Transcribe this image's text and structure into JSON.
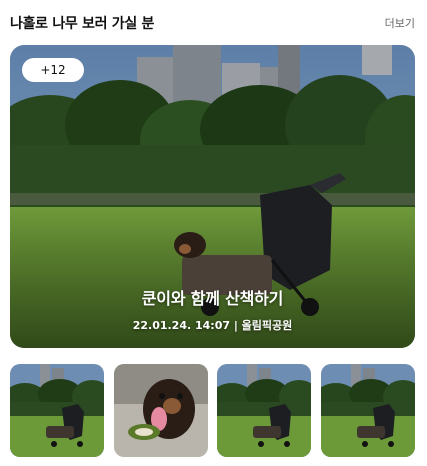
{
  "section": {
    "title": "나홀로 나무 보러 가실 분",
    "more_label": "더보기"
  },
  "hero": {
    "photo_count_badge": "+12",
    "post_title": "쿤이와 함께 산책하기",
    "meta": "22.01.24. 14:07 | 올림픽공원",
    "photo_icon": "park-dog-stroller-photo"
  },
  "thumbnails": [
    {
      "icon": "park-dog-stroller-photo"
    },
    {
      "icon": "dog-with-toy-photo"
    },
    {
      "icon": "park-dog-stroller-photo"
    },
    {
      "icon": "park-dog-stroller-photo"
    }
  ],
  "colors": {
    "sky": "#6f8fb3",
    "grass": "#6f9a3a",
    "trees": "#24421d",
    "text_dark": "#111111",
    "text_muted": "#666666"
  }
}
